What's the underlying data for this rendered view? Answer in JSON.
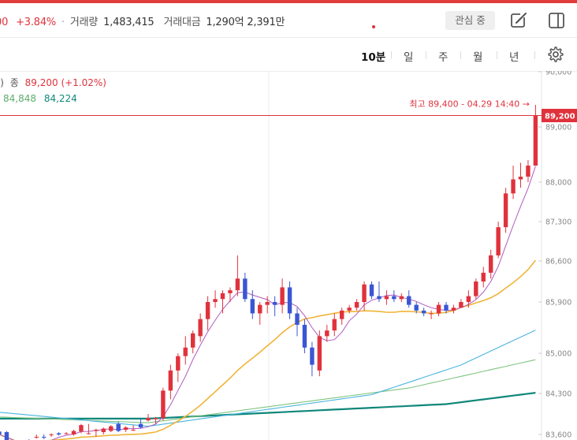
{
  "header": {
    "change_price_fragment": "00",
    "change_pct": "+3.84%",
    "separator": "·",
    "volume_label": "거래량",
    "volume_value": "1,483,415",
    "amount_label": "거래대금",
    "amount_value": "1,290억 2,391만",
    "watch_button": "관심 중",
    "edit_icon": "edit-icon",
    "layout_icon": "layout-icon"
  },
  "timeframes": [
    "10분",
    "일",
    "주",
    "월",
    "년"
  ],
  "active_timeframe": "10분",
  "legend": {
    "prefix": "s)",
    "close_label": "종",
    "close_value": "89,200 (+1.02%)",
    "ma_values": [
      {
        "text": "84,848",
        "color": "#5cad6a"
      },
      {
        "text": "84,224",
        "color": "#10877a"
      }
    ]
  },
  "chart_data": {
    "type": "candlestick",
    "y_ticks": [
      "90,000",
      "89,000",
      "88,000",
      "87,300",
      "86,600",
      "85,900",
      "85,000",
      "84,300",
      "83,600"
    ],
    "y_tick_values": [
      90000,
      89000,
      88000,
      87300,
      86600,
      85900,
      85000,
      84300,
      83600
    ],
    "high_annotation": "최고 89,400 - 04.29 14:40 →",
    "current_price_label": "89,200",
    "current_price": 89200,
    "colors": {
      "up": "#e0323c",
      "down": "#3a56d4",
      "ma5": "#b05ac0",
      "ma20": "#f0b437",
      "ma60": "#4ab4e0",
      "ma120": "#7fc47f",
      "ma240": "#10877a"
    },
    "candles": [
      [
        83650,
        83680,
        83560,
        83600
      ],
      [
        83640,
        83660,
        83480,
        83500
      ],
      [
        83450,
        83470,
        83380,
        83400
      ],
      [
        83400,
        83420,
        83320,
        83350
      ],
      [
        83500,
        83520,
        83420,
        83450
      ],
      [
        83560,
        83600,
        83530,
        83560
      ],
      [
        83560,
        83600,
        83520,
        83550
      ],
      [
        83600,
        83620,
        83560,
        83600
      ],
      [
        83620,
        83640,
        83580,
        83600
      ],
      [
        83620,
        83640,
        83600,
        83620
      ],
      [
        83600,
        83680,
        83580,
        83660
      ],
      [
        83650,
        83780,
        83620,
        83760
      ],
      [
        83620,
        83780,
        83600,
        83620
      ],
      [
        83660,
        83700,
        83560,
        83680
      ],
      [
        83640,
        83720,
        83600,
        83700
      ],
      [
        83660,
        83760,
        83640,
        83740
      ],
      [
        83780,
        83820,
        83640,
        83660
      ],
      [
        83680,
        83740,
        83640,
        83720
      ],
      [
        83680,
        83760,
        83660,
        83680
      ],
      [
        83780,
        83860,
        83700,
        83720
      ],
      [
        83840,
        83950,
        83820,
        83880
      ],
      [
        83860,
        83900,
        83780,
        83880
      ],
      [
        83880,
        84400,
        83840,
        84350
      ],
      [
        84350,
        84800,
        84200,
        84700
      ],
      [
        84700,
        85000,
        84500,
        84950
      ],
      [
        84950,
        85300,
        84800,
        85100
      ],
      [
        85100,
        85400,
        85000,
        85350
      ],
      [
        85300,
        85700,
        85200,
        85600
      ],
      [
        85600,
        86000,
        85400,
        85900
      ],
      [
        85900,
        86100,
        85800,
        85950
      ],
      [
        85950,
        86100,
        85700,
        86050
      ],
      [
        86050,
        86150,
        85900,
        86100
      ],
      [
        86100,
        86700,
        86000,
        86300
      ],
      [
        86300,
        86400,
        85900,
        85950
      ],
      [
        85950,
        86100,
        85600,
        85700
      ],
      [
        85700,
        85900,
        85500,
        85850
      ],
      [
        85850,
        86000,
        85700,
        85900
      ],
      [
        85900,
        86000,
        85650,
        85850
      ],
      [
        85850,
        86300,
        85700,
        86150
      ],
      [
        86150,
        86250,
        85600,
        85700
      ],
      [
        85700,
        85800,
        85300,
        85500
      ],
      [
        85500,
        85600,
        85000,
        85100
      ],
      [
        85100,
        85200,
        84600,
        84800
      ],
      [
        84700,
        85400,
        84600,
        85300
      ],
      [
        85300,
        85500,
        85200,
        85400
      ],
      [
        85400,
        85700,
        85300,
        85600
      ],
      [
        85600,
        85800,
        85500,
        85750
      ],
      [
        85750,
        85850,
        85700,
        85800
      ],
      [
        85800,
        85950,
        85750,
        85900
      ],
      [
        85900,
        86250,
        85750,
        86200
      ],
      [
        86200,
        86250,
        85950,
        86000
      ],
      [
        86000,
        86250,
        85900,
        85950
      ],
      [
        85950,
        86100,
        85850,
        86000
      ],
      [
        86000,
        86100,
        85900,
        85950
      ],
      [
        85950,
        86050,
        85900,
        86000
      ],
      [
        86000,
        86100,
        85800,
        85850
      ],
      [
        85850,
        85900,
        85700,
        85750
      ],
      [
        85750,
        85800,
        85650,
        85700
      ],
      [
        85700,
        85750,
        85600,
        85700
      ],
      [
        85700,
        85900,
        85650,
        85850
      ],
      [
        85850,
        85900,
        85700,
        85750
      ],
      [
        85750,
        85850,
        85700,
        85800
      ],
      [
        85800,
        85950,
        85800,
        85900
      ],
      [
        85900,
        86100,
        85800,
        86000
      ],
      [
        86000,
        86300,
        85950,
        86250
      ],
      [
        86250,
        86500,
        86150,
        86400
      ],
      [
        86400,
        86800,
        86300,
        86700
      ],
      [
        86700,
        87300,
        86650,
        87200
      ],
      [
        87200,
        87900,
        87100,
        87800
      ],
      [
        87800,
        88300,
        87700,
        88050
      ],
      [
        88050,
        88350,
        87900,
        88100
      ],
      [
        88100,
        88400,
        88000,
        88300
      ],
      [
        88300,
        89400,
        88300,
        89200
      ]
    ]
  }
}
